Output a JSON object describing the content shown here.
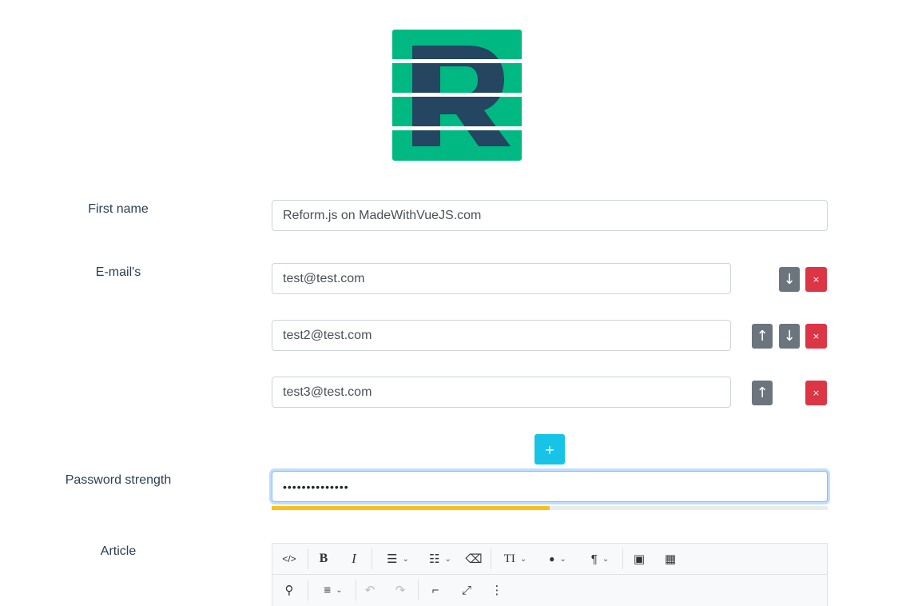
{
  "logo": {
    "letter": "R",
    "bg_color": "#00b982",
    "letter_color": "#254660"
  },
  "fields": {
    "first_name": {
      "label": "First name",
      "value": "Reform.js on MadeWithVueJS.com"
    },
    "emails": {
      "label": "E-mail's",
      "items": [
        {
          "value": "test@test.com"
        },
        {
          "value": "test2@test.com"
        },
        {
          "value": "test3@test.com"
        }
      ],
      "up_icon": "↑",
      "down_icon": "↓",
      "remove_icon": "×",
      "add_icon": "+"
    },
    "password": {
      "label": "Password strength",
      "value": "••••••••••••••",
      "strength_fraction": 0.5,
      "strength_color": "#f8c11a"
    },
    "article": {
      "label": "Article",
      "toolbar": {
        "code_view": "</>",
        "bold": "B",
        "italic": "I",
        "unordered_list": "☰",
        "ordered_list": "☷",
        "eraser": "⌫",
        "font_size": "TI",
        "color": "●",
        "paragraph": "¶",
        "picture": "▣",
        "table": "▦",
        "link": "⚲",
        "align": "≡",
        "undo": "↶",
        "redo": "↷",
        "format_painter": "⌐",
        "fullscreen": "⤢",
        "more": "⋮",
        "caret": "⌄"
      }
    }
  }
}
